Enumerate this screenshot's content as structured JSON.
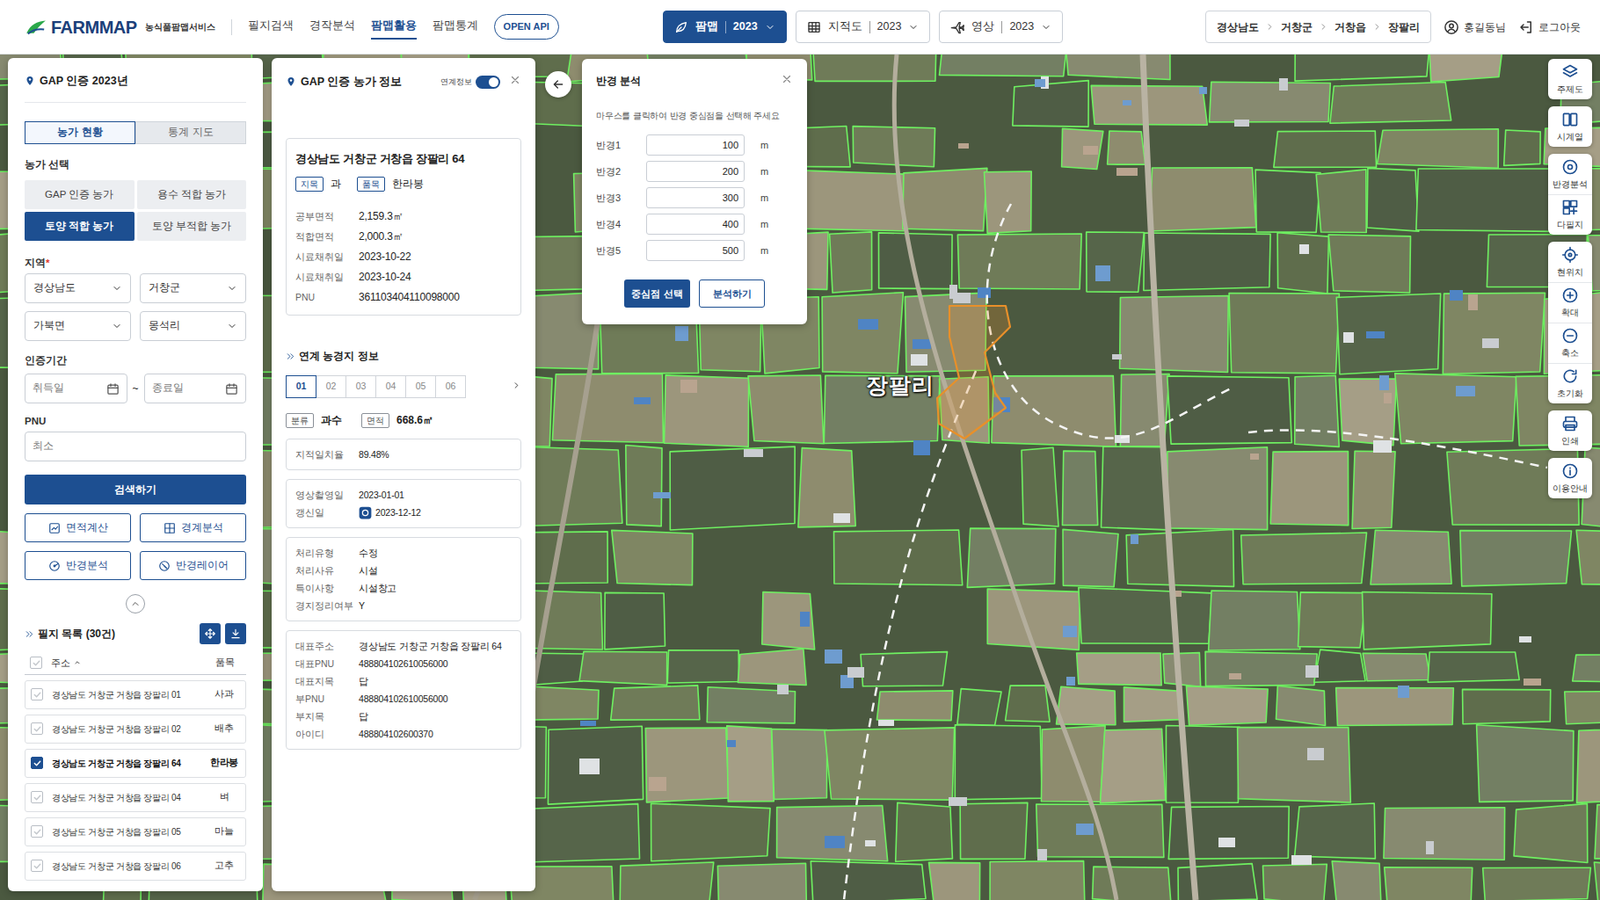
{
  "header": {
    "logo": "FARMMAP",
    "logo_sub": "농식품팜맵서비스",
    "nav": [
      {
        "label": "필지검색",
        "selected": false
      },
      {
        "label": "경작분석",
        "selected": false
      },
      {
        "label": "팜맵활용",
        "selected": true
      },
      {
        "label": "팜맵통계",
        "selected": false
      }
    ],
    "open_api": "OPEN API",
    "layers": [
      {
        "label": "팜맵",
        "year": "2023",
        "selected": true
      },
      {
        "label": "지적도",
        "year": "2023",
        "selected": false
      },
      {
        "label": "영상",
        "year": "2023",
        "selected": false
      }
    ],
    "breadcrumb": [
      "경상남도",
      "거창군",
      "거창읍",
      "장팔리"
    ],
    "user": "홍길동님",
    "logout": "로그아웃"
  },
  "left_panel": {
    "title": "GAP 인증 2023년",
    "tabs": [
      {
        "label": "농가 현황",
        "selected": true
      },
      {
        "label": "통계 지도",
        "selected": false
      }
    ],
    "farm_select": {
      "label": "농가 선택",
      "options": [
        {
          "label": "GAP 인증 농가",
          "selected": false
        },
        {
          "label": "용수 적합 농가",
          "selected": false
        },
        {
          "label": "토양 적합 농가",
          "selected": true
        },
        {
          "label": "토양 부적합 농가",
          "selected": false
        }
      ]
    },
    "region": {
      "label": "지역",
      "required_mark": "*",
      "selects": [
        "경상남도",
        "거창군",
        "가북면",
        "몽석리"
      ]
    },
    "period": {
      "label": "인증기간",
      "start_placeholder": "취득일",
      "separator": "~",
      "end_placeholder": "종료일"
    },
    "pnu": {
      "label": "PNU",
      "placeholder": "최소"
    },
    "search_button": "검색하기",
    "tools": [
      "면적계산",
      "경계분석",
      "반경분석",
      "반경레이어"
    ],
    "list": {
      "title": "필지 목록 (30건)",
      "columns": [
        "주소",
        "품목"
      ],
      "header_checked": false,
      "rows": [
        {
          "address": "경상남도 거창군 거창읍 장팔리 01",
          "crop": "사과",
          "checked": false
        },
        {
          "address": "경상남도 거창군 거창읍 장팔리 02",
          "crop": "배추",
          "checked": false
        },
        {
          "address": "경상남도 거창군 거창읍 장팔리 64",
          "crop": "한라봉",
          "checked": true
        },
        {
          "address": "경상남도 거창군 거창읍 장팔리 04",
          "crop": "벼",
          "checked": false
        },
        {
          "address": "경상남도 거창군 거창읍 장팔리 05",
          "crop": "마늘",
          "checked": false
        },
        {
          "address": "경상남도 거창군 거창읍 장팔리 06",
          "crop": "고추",
          "checked": false
        }
      ]
    }
  },
  "info_panel": {
    "title": "GAP 인증 농가 정보",
    "toggle": {
      "label": "연계정보",
      "on": true
    },
    "card": {
      "address": "경상남도 거창군 거창읍 장팔리 64",
      "tags": [
        {
          "tag": "지목",
          "value": "과"
        },
        {
          "tag": "품목",
          "value": "한라봉"
        }
      ],
      "rows": [
        {
          "label": "공부면적",
          "value": "2,159.3㎡"
        },
        {
          "label": "적합면적",
          "value": "2,000.3㎡"
        },
        {
          "label": "시료채취일",
          "value": "2023-10-22"
        },
        {
          "label": "시료채취일",
          "value": "2023-10-24"
        },
        {
          "label": "PNU",
          "value": "361103404110098000"
        }
      ]
    },
    "linked": {
      "title": "연계 농경지 정보",
      "tabs": [
        {
          "label": "01",
          "selected": true
        },
        {
          "label": "02",
          "selected": false
        },
        {
          "label": "03",
          "selected": false
        },
        {
          "label": "04",
          "selected": false
        },
        {
          "label": "05",
          "selected": false
        },
        {
          "label": "06",
          "selected": false
        }
      ],
      "summary": [
        {
          "tag": "분류",
          "value": "과수"
        },
        {
          "tag": "면적",
          "value": "668.6㎡"
        }
      ],
      "groups": [
        {
          "rows": [
            {
              "label": "지적일치율",
              "value": "89.48%",
              "kind": "plain"
            }
          ]
        },
        {
          "rows": [
            {
              "label": "영상촬영일",
              "value": "2023-01-01",
              "kind": "plain"
            },
            {
              "label": "갱신일",
              "value": "2023-12-12",
              "kind": "updated"
            }
          ]
        },
        {
          "rows": [
            {
              "label": "처리유형",
              "value": "수정",
              "kind": "plain"
            },
            {
              "label": "처리사유",
              "value": "시설",
              "kind": "plain"
            },
            {
              "label": "특이사항",
              "value": "시설창고",
              "kind": "plain"
            },
            {
              "label": "경지정리여부",
              "value": "Y",
              "kind": "plain"
            }
          ]
        },
        {
          "rows": [
            {
              "label": "대표주소",
              "value": "경상남도 거창군 거창읍 장팔리 64",
              "kind": "plain"
            },
            {
              "label": "대표PNU",
              "value": "488804102610056000",
              "kind": "plain"
            },
            {
              "label": "대표지목",
              "value": "답",
              "kind": "plain"
            },
            {
              "label": "부PNU",
              "value": "488804102610056000",
              "kind": "plain"
            },
            {
              "label": "부지목",
              "value": "답",
              "kind": "plain"
            },
            {
              "label": "아이디",
              "value": "488804102600370",
              "kind": "plain"
            }
          ]
        }
      ]
    }
  },
  "radius_panel": {
    "title": "반경 분석",
    "hint": "마우스를 클릭하여 반경 중심점을 선택해 주세요",
    "rows": [
      {
        "label": "반경1",
        "value": "100",
        "unit": "m"
      },
      {
        "label": "반경2",
        "value": "200",
        "unit": "m"
      },
      {
        "label": "반경3",
        "value": "300",
        "unit": "m"
      },
      {
        "label": "반경4",
        "value": "400",
        "unit": "m"
      },
      {
        "label": "반경5",
        "value": "500",
        "unit": "m"
      }
    ],
    "buttons": [
      {
        "label": "중심점 선택",
        "kind": "primary"
      },
      {
        "label": "분석하기",
        "kind": "outline"
      }
    ]
  },
  "map": {
    "label": "장팔리"
  },
  "toolbar": {
    "groups": [
      {
        "items": [
          "주제도"
        ]
      },
      {
        "items": [
          "시계열"
        ]
      },
      {
        "items": [
          "반경분석",
          "다필지"
        ]
      },
      {
        "items": [
          "현위치",
          "확대",
          "축소",
          "초기화"
        ]
      },
      {
        "items": [
          "인쇄"
        ]
      },
      {
        "items": [
          "이용안내"
        ]
      }
    ]
  }
}
